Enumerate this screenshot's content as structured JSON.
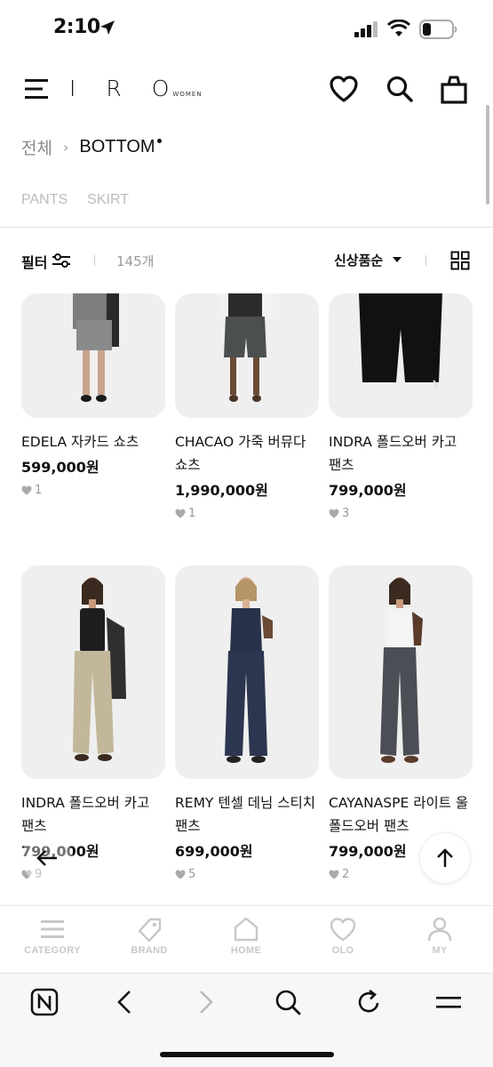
{
  "status": {
    "time": "2:10"
  },
  "header": {
    "logo": "IRO",
    "logo_sub": "WOMEN"
  },
  "breadcrumb": {
    "root": "전체",
    "separator": "›",
    "current": "BOTTOM"
  },
  "subcategories": [
    "PANTS",
    "SKIRT"
  ],
  "filter_bar": {
    "filter_label": "필터",
    "count": "145개",
    "sort_label": "신상품순"
  },
  "products": [
    {
      "name": "EDELA 자카드 쇼츠",
      "price": "599,000원",
      "likes": "1"
    },
    {
      "name": "CHACAO 가죽 버뮤다 쇼츠",
      "price": "1,990,000원",
      "likes": "1"
    },
    {
      "name": "INDRA 폴드오버 카고 팬츠",
      "price": "799,000원",
      "likes": "3"
    },
    {
      "name": "INDRA 폴드오버 카고 팬츠",
      "price": "799,000원",
      "likes": "9"
    },
    {
      "name": "REMY 텐셀 데님 스티치 팬츠",
      "price": "699,000원",
      "likes": "5"
    },
    {
      "name": "CAYANASPE 라이트 울 폴드오버 팬츠",
      "price": "799,000원",
      "likes": "2"
    }
  ],
  "tabs": [
    {
      "label": "CATEGORY",
      "icon": "category-icon"
    },
    {
      "label": "BRAND",
      "icon": "tag-icon"
    },
    {
      "label": "HOME",
      "icon": "home-icon"
    },
    {
      "label": "OLO",
      "icon": "heart-icon"
    },
    {
      "label": "MY",
      "icon": "person-icon"
    }
  ],
  "browser_toolbar": [
    "n-logo-icon",
    "back-icon",
    "forward-icon",
    "search-icon",
    "refresh-icon",
    "menu-icon"
  ],
  "colors": {
    "text": "#111111",
    "muted": "#999999",
    "card_bg": "#efefef",
    "tab_inactive": "#c8c8c8"
  }
}
